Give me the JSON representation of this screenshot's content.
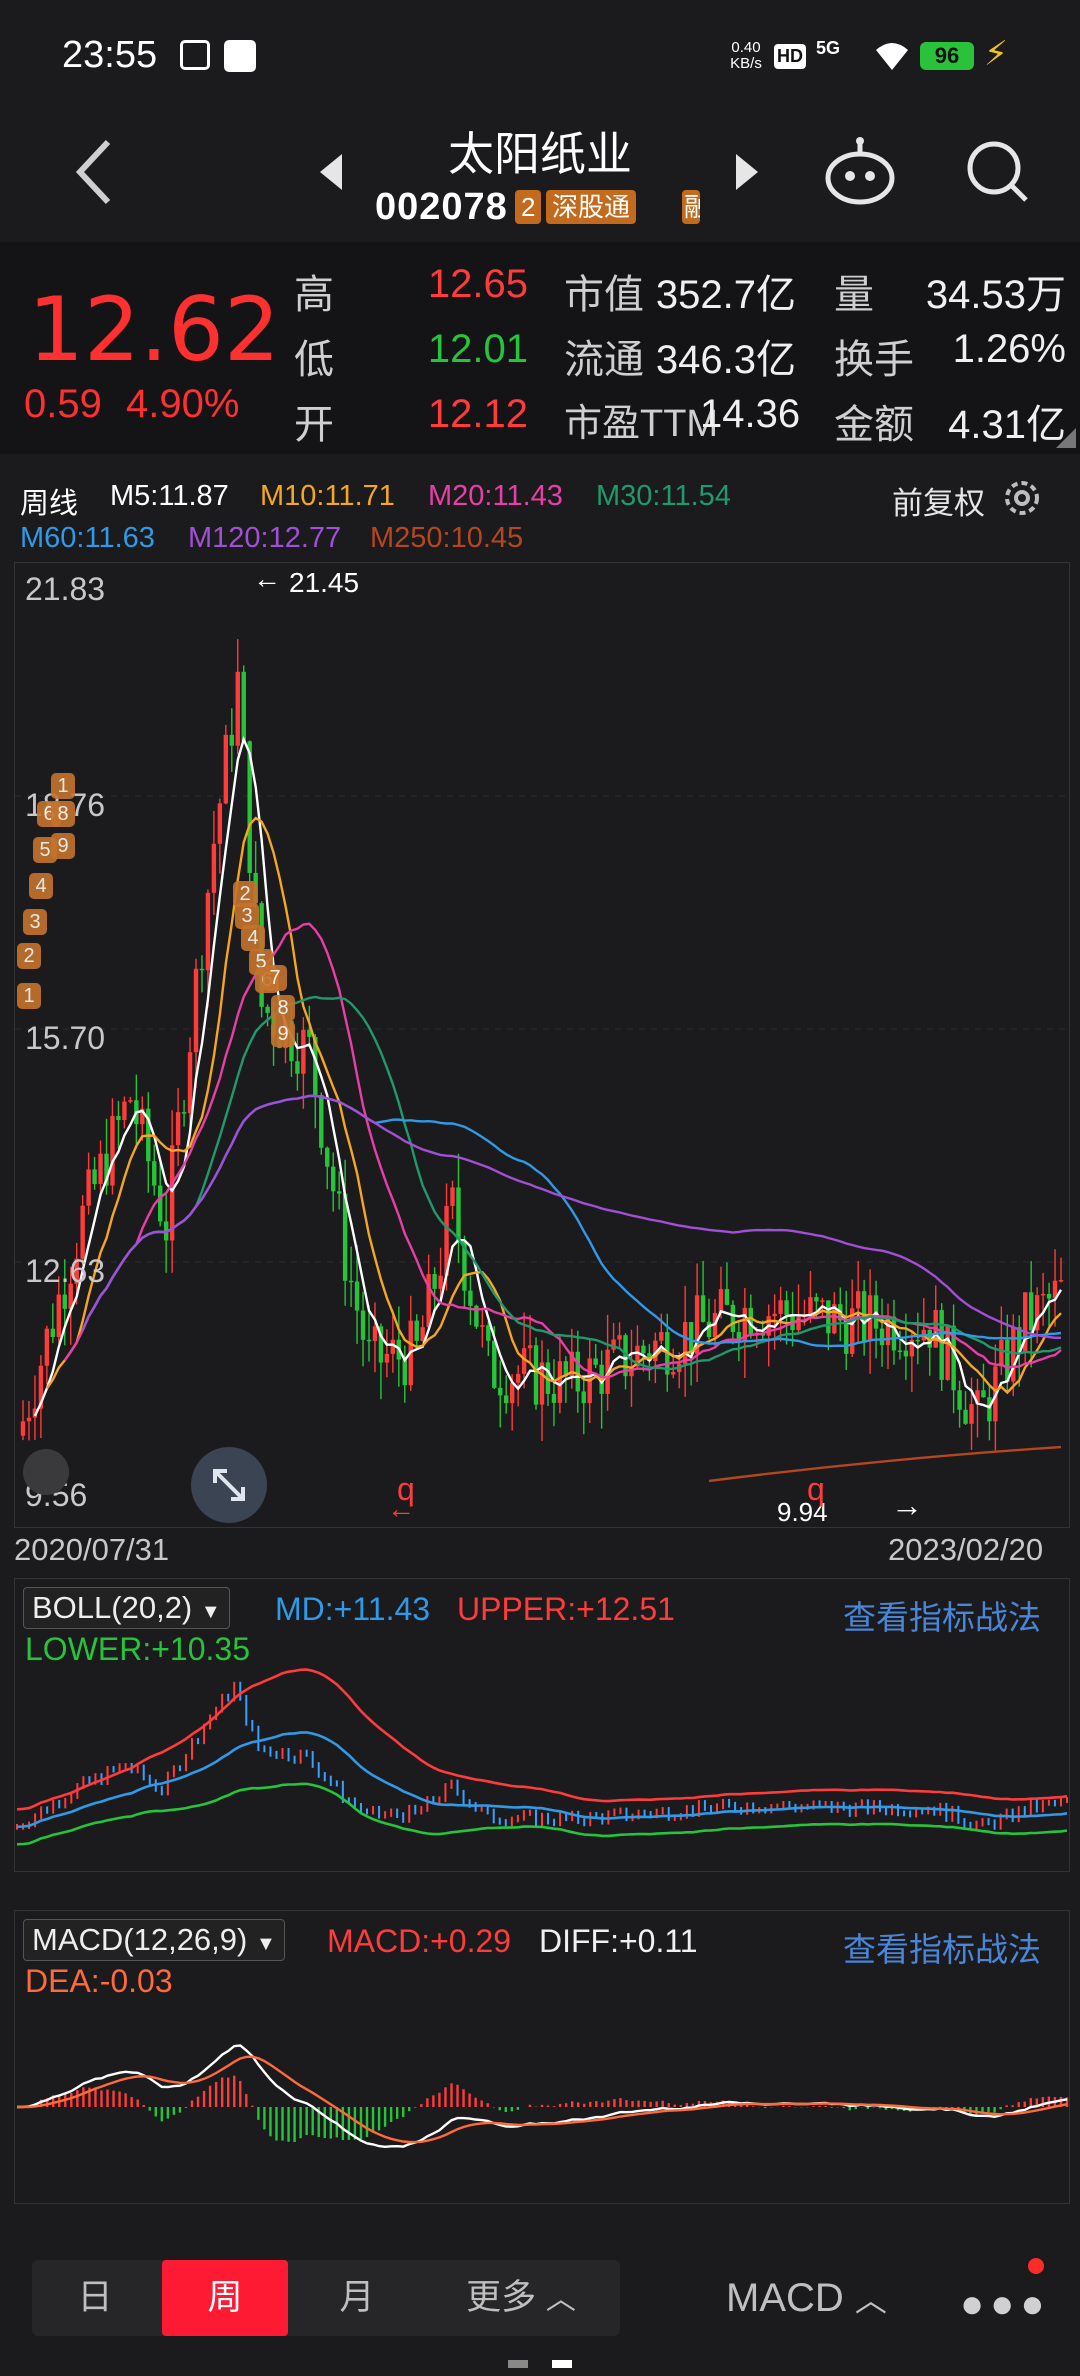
{
  "status": {
    "time": "23:55",
    "net_speed_top": "0.40",
    "net_speed_bottom": "KB/s",
    "hd": "HD",
    "signal": "5G",
    "battery": "96"
  },
  "header": {
    "stock_name": "太阳纸业",
    "stock_code": "002078",
    "tag_num": "2",
    "tag_exchange": "深股通",
    "tag_partial": "融"
  },
  "quote": {
    "price": "12.62",
    "change": "0.59",
    "change_pct": "4.90%",
    "high_label": "高",
    "high": "12.65",
    "low_label": "低",
    "low": "12.01",
    "open_label": "开",
    "open": "12.12",
    "mktcap_label": "市值",
    "mktcap": "352.7亿",
    "float_label": "流通",
    "float": "346.3亿",
    "pe_label": "市盈TTM",
    "pe": "14.36",
    "vol_label": "量",
    "vol": "34.53万",
    "turnover_label": "换手",
    "turnover": "1.26%",
    "amount_label": "金额",
    "amount": "4.31亿"
  },
  "chart_header": {
    "period": "周线",
    "ma5": "M5:11.87",
    "ma10": "M10:11.71",
    "ma20": "M20:11.43",
    "ma30": "M30:11.54",
    "ma60": "M60:11.63",
    "ma120": "M120:12.77",
    "ma250": "M250:10.45",
    "adjust": "前复权"
  },
  "main_chart": {
    "y_labels": [
      "21.83",
      "18.76",
      "15.70",
      "12.63",
      "9.56"
    ],
    "high_mark": "21.45",
    "low_mark": "9.94",
    "start_date": "2020/07/31",
    "end_date": "2023/02/20",
    "markers": [
      "1",
      "2",
      "3",
      "4",
      "5",
      "6",
      "8",
      "9",
      "1",
      "2",
      "3",
      "4",
      "5",
      "6",
      "7",
      "8",
      "9"
    ],
    "q_left": "q",
    "q_right": "q"
  },
  "boll": {
    "selector": "BOLL(20,2)",
    "md": "MD:+11.43",
    "upper": "UPPER:+12.51",
    "lower": "LOWER:+10.35",
    "link": "查看指标战法"
  },
  "macd": {
    "selector": "MACD(12,26,9)",
    "macd": "MACD:+0.29",
    "diff": "DIFF:+0.11",
    "dea": "DEA:-0.03",
    "link": "查看指标战法"
  },
  "bottom_nav": {
    "day": "日",
    "week": "周",
    "month": "月",
    "more": "更多",
    "indicator": "MACD"
  },
  "colors": {
    "up": "#ff3b3b",
    "down": "#25c43b",
    "ma5": "#ffffff",
    "ma10": "#f5a623",
    "ma20": "#e83fa6",
    "ma30": "#1f9a6b",
    "ma60": "#2e9ae8",
    "ma120": "#a24fd8",
    "ma250": "#b5461f"
  }
}
